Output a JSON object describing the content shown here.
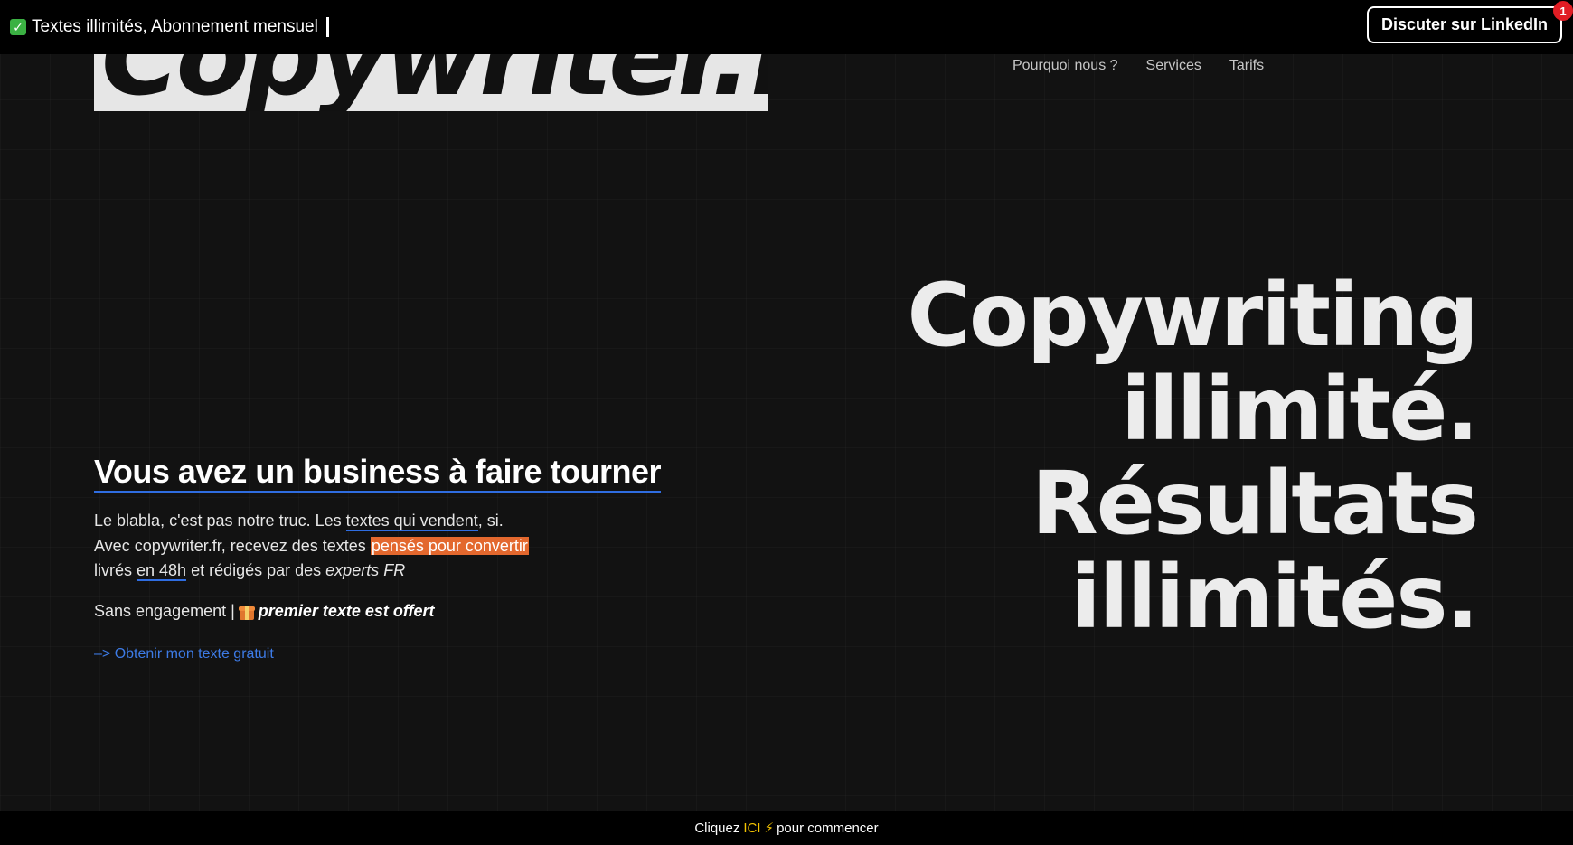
{
  "announcement": {
    "text": "Textes illimités, Abonnement mensuel"
  },
  "linkedin": {
    "label": "Discuter sur LinkedIn",
    "badge": "1"
  },
  "logo": {
    "text": "Copywriter.fr"
  },
  "nav": [
    {
      "label": "Pourquoi nous ?"
    },
    {
      "label": "Services"
    },
    {
      "label": "Tarifs"
    }
  ],
  "hero": {
    "heading": "Vous avez un business à faire tourner",
    "line1_a": "Le blabla, c'est pas notre truc. Les ",
    "line1_link": "textes qui vendent",
    "line1_b": ", si.",
    "line2_a": "Avec copywriter.fr, recevez des textes ",
    "line2_highlight": "pensés pour convertir",
    "line3_a": "livrés ",
    "line3_u": "en 48h",
    "line3_b": " et rédigés par des ",
    "line3_em": "experts FR",
    "offer_a": "Sans engagement | ",
    "offer_strong": "premier texte est offert",
    "cta": "–> Obtenir mon texte gratuit"
  },
  "headline": {
    "line1": "Copywriting",
    "line2": "illimité.",
    "line3": "Résultats",
    "line4": "illimités."
  },
  "bottombar": {
    "a": "Cliquez",
    "ici": "ICI",
    "b": "pour commencer"
  },
  "colors": {
    "accent_blue": "#2f6de1",
    "accent_orange": "#e3682e",
    "accent_yellow": "#f2c200"
  }
}
